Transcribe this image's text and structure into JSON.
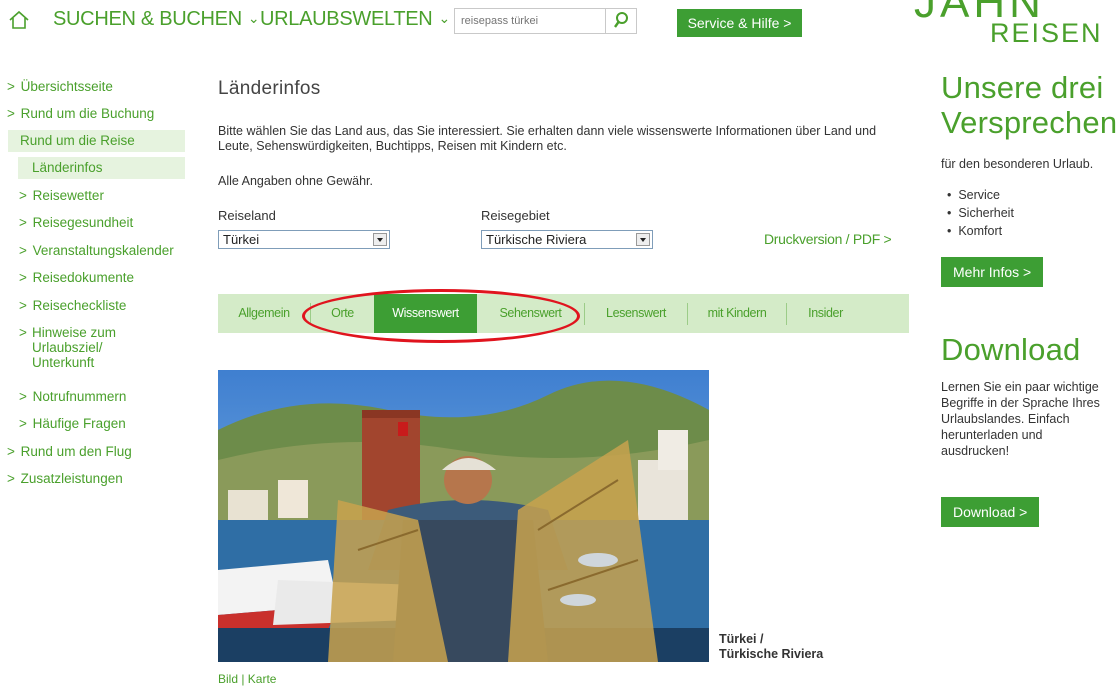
{
  "nav": {
    "items": [
      {
        "label": "SUCHEN & BUCHEN",
        "chevron": "⌄"
      },
      {
        "label": "URLAUBSWELTEN",
        "chevron": "⌄"
      }
    ],
    "search_placeholder": "reisepass türkei",
    "search_icon": "search-icon",
    "service_label": "Service & Hilfe >",
    "logo_top": "JAHN",
    "logo_bottom": "REISEN"
  },
  "sidebar": {
    "items": [
      {
        "arrow": ">",
        "label": "Übersichtsseite"
      },
      {
        "arrow": ">",
        "label": "Rund um die Buchung"
      },
      {
        "arrow": "",
        "label": "Rund um die Reise"
      },
      {
        "arrow": "",
        "label": "Länderinfos"
      },
      {
        "arrow": ">",
        "label": "Reisewetter"
      },
      {
        "arrow": ">",
        "label": "Reisegesundheit"
      },
      {
        "arrow": ">",
        "label": "Veranstaltungskalender"
      },
      {
        "arrow": ">",
        "label": "Reisedokumente"
      },
      {
        "arrow": ">",
        "label": "Reisecheckliste"
      },
      {
        "arrow": ">",
        "label": "Hinweise zum Urlaubsziel/ Unterkunft"
      },
      {
        "arrow": ">",
        "label": "Notrufnummern"
      },
      {
        "arrow": ">",
        "label": "Häufige Fragen"
      },
      {
        "arrow": ">",
        "label": "Rund um den Flug"
      },
      {
        "arrow": ">",
        "label": "Zusatzleistungen"
      }
    ]
  },
  "main": {
    "title": "Länderinfos",
    "intro": "Bitte wählen Sie das Land aus, das Sie interessiert. Sie erhalten dann viele wissenswerte Informationen über Land und Leute, Sehenswürdigkeiten, Buchtipps, Reisen mit Kindern etc.",
    "disclaimer": "Alle Angaben ohne Gewähr.",
    "country_label": "Reiseland",
    "country_value": "Türkei",
    "region_label": "Reisegebiet",
    "region_value": "Türkische Riviera",
    "print_link": "Druckversion / PDF  >",
    "tabs": [
      "Allgemein",
      "Orte",
      "Wissenswert",
      "Sehenswert",
      "Lesenswert",
      "mit Kindern",
      "Insider"
    ],
    "active_tab": "Wissenswert",
    "caption_line1": "Türkei /",
    "caption_line2": "Türkische Riviera",
    "bildkarte": "Bild | Karte"
  },
  "right": {
    "promo_title_1": "Unsere drei",
    "promo_title_2": "Versprechen",
    "promo_sub": "für den besonderen Urlaub.",
    "bullets": [
      "Service",
      "Sicherheit",
      "Komfort"
    ],
    "more_label": "Mehr Infos  >",
    "download_title": "Download",
    "download_text": "Lernen Sie ein paar wichtige Begriffe in der Sprache Ihres Urlaubslandes. Einfach herunterladen und ausdrucken!",
    "download_label": "Download  >"
  },
  "colors": {
    "brand_green": "#3d9e34",
    "link_green": "#4aa02c",
    "tab_bar": "#d4ebc8",
    "highlight_red": "#e0141e"
  }
}
